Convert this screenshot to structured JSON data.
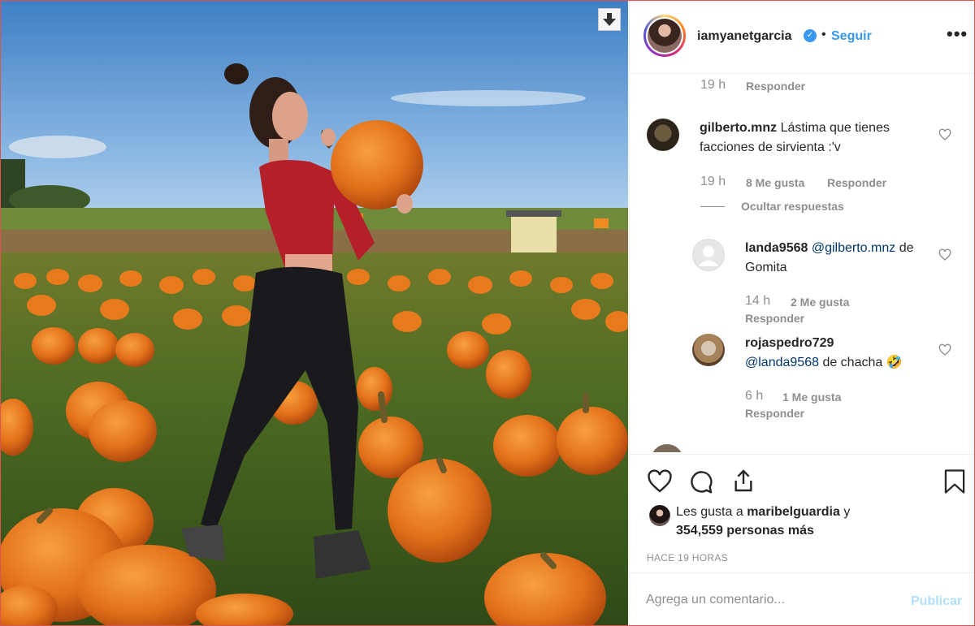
{
  "post": {
    "username": "iamyanetgarcia",
    "follow_label": "Seguir",
    "more_label": "•••",
    "dot": "•"
  },
  "comments": [
    {
      "meta_time": "19 h",
      "meta_reply": "Responder"
    },
    {
      "username": "gilberto.mnz",
      "text": "Lástima que tienes facciones de sirvienta :'v",
      "time": "19 h",
      "likes": "8 Me gusta",
      "reply": "Responder",
      "hide_replies": "Ocultar respuestas"
    },
    {
      "username": "landa9568",
      "mention": "@gilberto.mnz",
      "text": "de Gomita",
      "time": "14 h",
      "likes": "2 Me gusta",
      "reply": "Responder"
    },
    {
      "username": "rojaspedro729",
      "mention": "@landa9568",
      "text": "de chacha 🤣",
      "time": "6 h",
      "likes": "1 Me gusta",
      "reply": "Responder"
    }
  ],
  "likes": {
    "prefix": "Les gusta a",
    "user": "maribelguardia",
    "suffix": "y",
    "others": "354,559 personas más"
  },
  "timestamp": "HACE 19 HORAS",
  "add_comment": {
    "placeholder": "Agrega un comentario...",
    "publish_label": "Publicar"
  },
  "colors": {
    "link_blue": "#3897f0",
    "publish_disabled": "#b2dffc",
    "meta_gray": "#8e8e8e"
  },
  "icons": [
    "download-icon",
    "verified-icon",
    "more-icon",
    "heart-icon",
    "comment-icon",
    "share-icon",
    "bookmark-icon"
  ]
}
